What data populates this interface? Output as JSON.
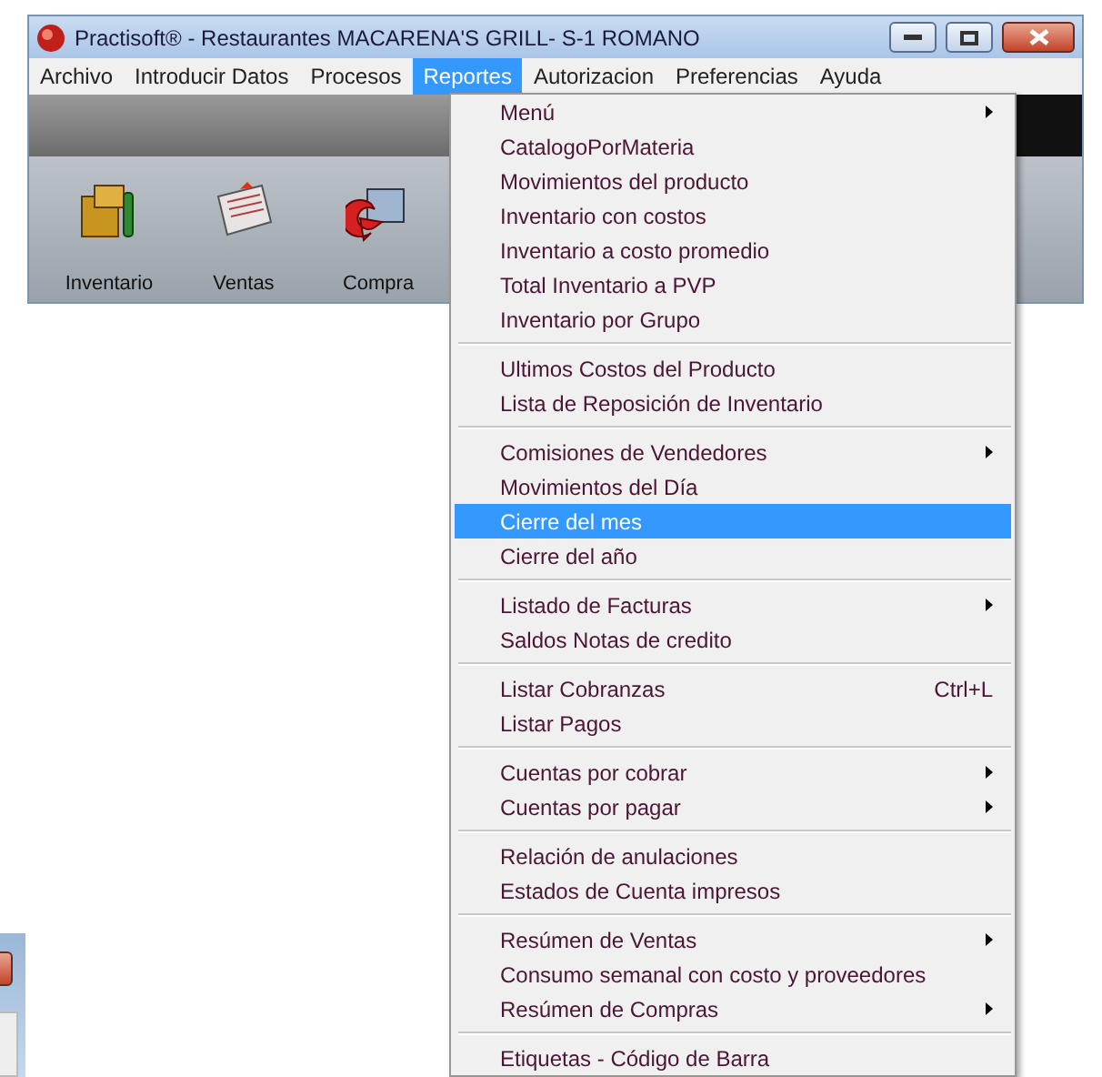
{
  "window": {
    "title": "Practisoft® - Restaurantes MACARENA'S GRILL- S-1 ROMANO"
  },
  "menu_bar": [
    {
      "label": "Archivo",
      "selected": false
    },
    {
      "label": "Introducir Datos",
      "selected": false
    },
    {
      "label": "Procesos",
      "selected": false
    },
    {
      "label": "Reportes",
      "selected": true
    },
    {
      "label": "Autorizacion",
      "selected": false
    },
    {
      "label": "Preferencias",
      "selected": false
    },
    {
      "label": "Ayuda",
      "selected": false
    }
  ],
  "toolbar": [
    {
      "label": "Inventario",
      "kind": "boxes"
    },
    {
      "label": "Ventas",
      "kind": "papers"
    },
    {
      "label": "Compra",
      "kind": "box-arrow"
    }
  ],
  "dropdown": {
    "groups": [
      [
        {
          "label": "Menú",
          "submenu": true,
          "selected": false
        },
        {
          "label": "CatalogoPorMateria",
          "submenu": false,
          "selected": false
        },
        {
          "label": "Movimientos del producto",
          "submenu": false,
          "selected": false
        },
        {
          "label": "Inventario con costos",
          "submenu": false,
          "selected": false
        },
        {
          "label": "Inventario a costo promedio",
          "submenu": false,
          "selected": false
        },
        {
          "label": "Total Inventario a PVP",
          "submenu": false,
          "selected": false
        },
        {
          "label": "Inventario por Grupo",
          "submenu": false,
          "selected": false
        }
      ],
      [
        {
          "label": "Ultimos Costos del Producto",
          "submenu": false,
          "selected": false
        },
        {
          "label": "Lista de Reposición de Inventario",
          "submenu": false,
          "selected": false
        }
      ],
      [
        {
          "label": "Comisiones de Vendedores",
          "submenu": true,
          "selected": false
        },
        {
          "label": "Movimientos del Día",
          "submenu": false,
          "selected": false
        },
        {
          "label": "Cierre del mes",
          "submenu": false,
          "selected": true
        },
        {
          "label": "Cierre del año",
          "submenu": false,
          "selected": false
        }
      ],
      [
        {
          "label": "Listado de Facturas",
          "submenu": true,
          "selected": false
        },
        {
          "label": "Saldos Notas de credito",
          "submenu": false,
          "selected": false
        }
      ],
      [
        {
          "label": "Listar Cobranzas",
          "submenu": false,
          "selected": false,
          "shortcut": "Ctrl+L"
        },
        {
          "label": "Listar Pagos",
          "submenu": false,
          "selected": false
        }
      ],
      [
        {
          "label": "Cuentas por cobrar",
          "submenu": true,
          "selected": false
        },
        {
          "label": "Cuentas por pagar",
          "submenu": true,
          "selected": false
        }
      ],
      [
        {
          "label": "Relación de anulaciones",
          "submenu": false,
          "selected": false
        },
        {
          "label": "Estados de Cuenta impresos",
          "submenu": false,
          "selected": false
        }
      ],
      [
        {
          "label": "Resúmen de Ventas",
          "submenu": true,
          "selected": false
        },
        {
          "label": "Consumo semanal con costo y proveedores",
          "submenu": false,
          "selected": false
        },
        {
          "label": "Resúmen de Compras",
          "submenu": true,
          "selected": false
        }
      ],
      [
        {
          "label": "Etiquetas - Código de Barra",
          "submenu": false,
          "selected": false
        }
      ]
    ]
  }
}
